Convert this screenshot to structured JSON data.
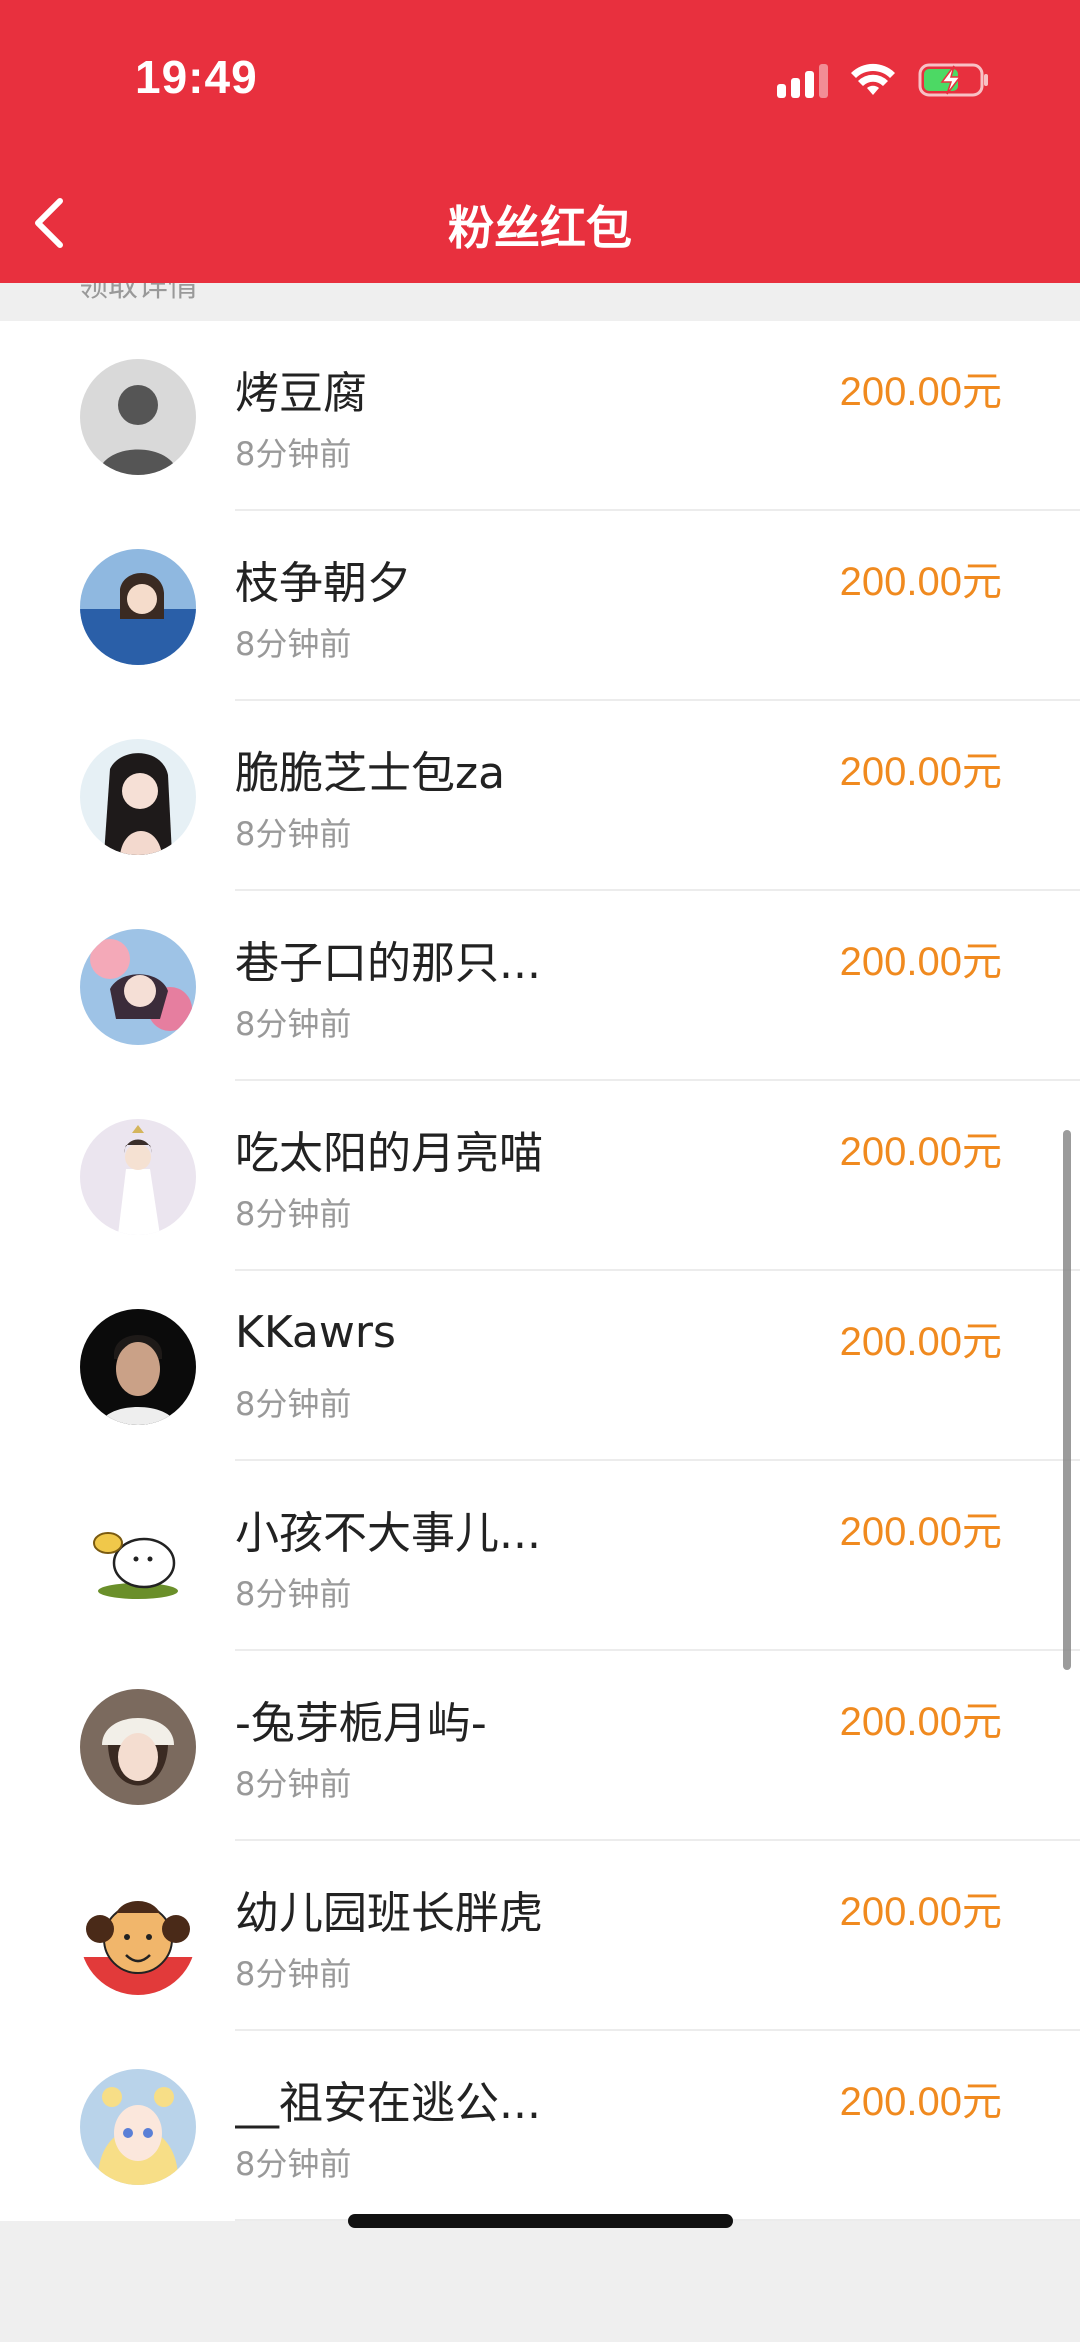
{
  "status_bar": {
    "time": "19:49"
  },
  "nav": {
    "title": "粉丝红包"
  },
  "section": {
    "label": "领取详情"
  },
  "colors": {
    "header": "#e8303e",
    "amount": "#f08a1f"
  },
  "recipients": [
    {
      "name": "烤豆腐",
      "time": "8分钟前",
      "amount": "200.00元",
      "avatar": "silhouette-avatar"
    },
    {
      "name": "枝争朝夕",
      "time": "8分钟前",
      "amount": "200.00元",
      "avatar": "photo-avatar"
    },
    {
      "name": "脆脆芝士包za",
      "time": "8分钟前",
      "amount": "200.00元",
      "avatar": "photo-avatar"
    },
    {
      "name": "巷子口的那只...",
      "time": "8分钟前",
      "amount": "200.00元",
      "avatar": "photo-avatar"
    },
    {
      "name": "吃太阳的月亮喵",
      "time": "8分钟前",
      "amount": "200.00元",
      "avatar": "illustration-avatar"
    },
    {
      "name": "KKawrs",
      "time": "8分钟前",
      "amount": "200.00元",
      "avatar": "photo-avatar"
    },
    {
      "name": "小孩不大事儿...",
      "time": "8分钟前",
      "amount": "200.00元",
      "avatar": "cartoon-dog-avatar"
    },
    {
      "name": "-兔芽栀月屿-",
      "time": "8分钟前",
      "amount": "200.00元",
      "avatar": "photo-avatar"
    },
    {
      "name": "幼儿园班长胖虎",
      "time": "8分钟前",
      "amount": "200.00元",
      "avatar": "cartoon-avatar"
    },
    {
      "name": "__祖安在逃公...",
      "time": "8分钟前",
      "amount": "200.00元",
      "avatar": "anime-avatar"
    }
  ]
}
